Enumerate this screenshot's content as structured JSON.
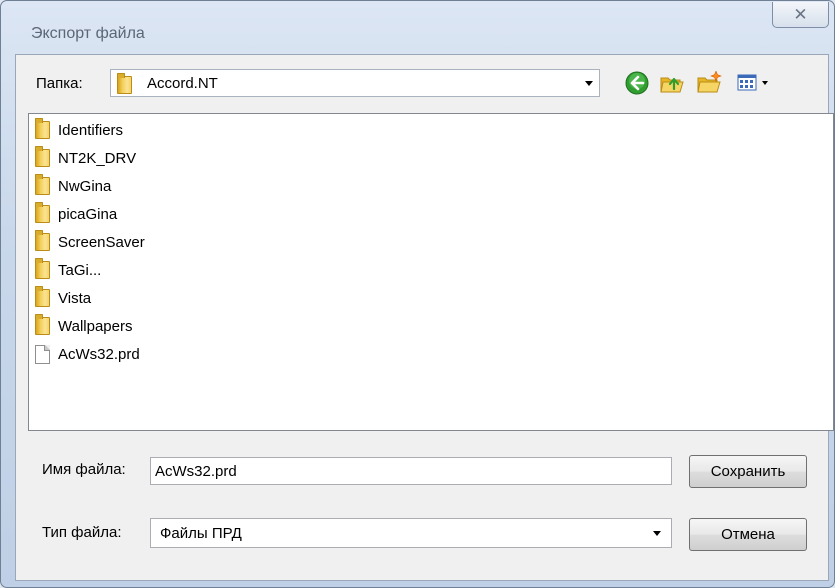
{
  "window": {
    "title": "Экспорт файла",
    "close_glyph": "✕"
  },
  "toolbar": {
    "folder_label": "Папка:",
    "current_folder": "Accord.NT",
    "buttons": [
      {
        "name": "back-icon"
      },
      {
        "name": "up-folder-icon"
      },
      {
        "name": "new-folder-icon"
      },
      {
        "name": "view-menu-icon"
      }
    ]
  },
  "file_list": {
    "items": [
      {
        "name": "Identifiers",
        "kind": "folder"
      },
      {
        "name": "NT2K_DRV",
        "kind": "folder"
      },
      {
        "name": "NwGina",
        "kind": "folder"
      },
      {
        "name": "picaGina",
        "kind": "folder"
      },
      {
        "name": "ScreenSaver",
        "kind": "folder"
      },
      {
        "name": "TaGi...",
        "kind": "folder"
      },
      {
        "name": "Vista",
        "kind": "folder"
      },
      {
        "name": "Wallpapers",
        "kind": "folder"
      },
      {
        "name": "AcWs32.prd",
        "kind": "file"
      }
    ]
  },
  "form": {
    "filename_label": "Имя файла:",
    "filename_value": "AcWs32.prd",
    "filetype_label": "Тип файла:",
    "filetype_value": "Файлы ПРД",
    "save_label": "Сохранить",
    "cancel_label": "Отмена"
  },
  "colors": {
    "back_green": "#2f9e2f",
    "folder_yellow": "#f3cf5c"
  }
}
